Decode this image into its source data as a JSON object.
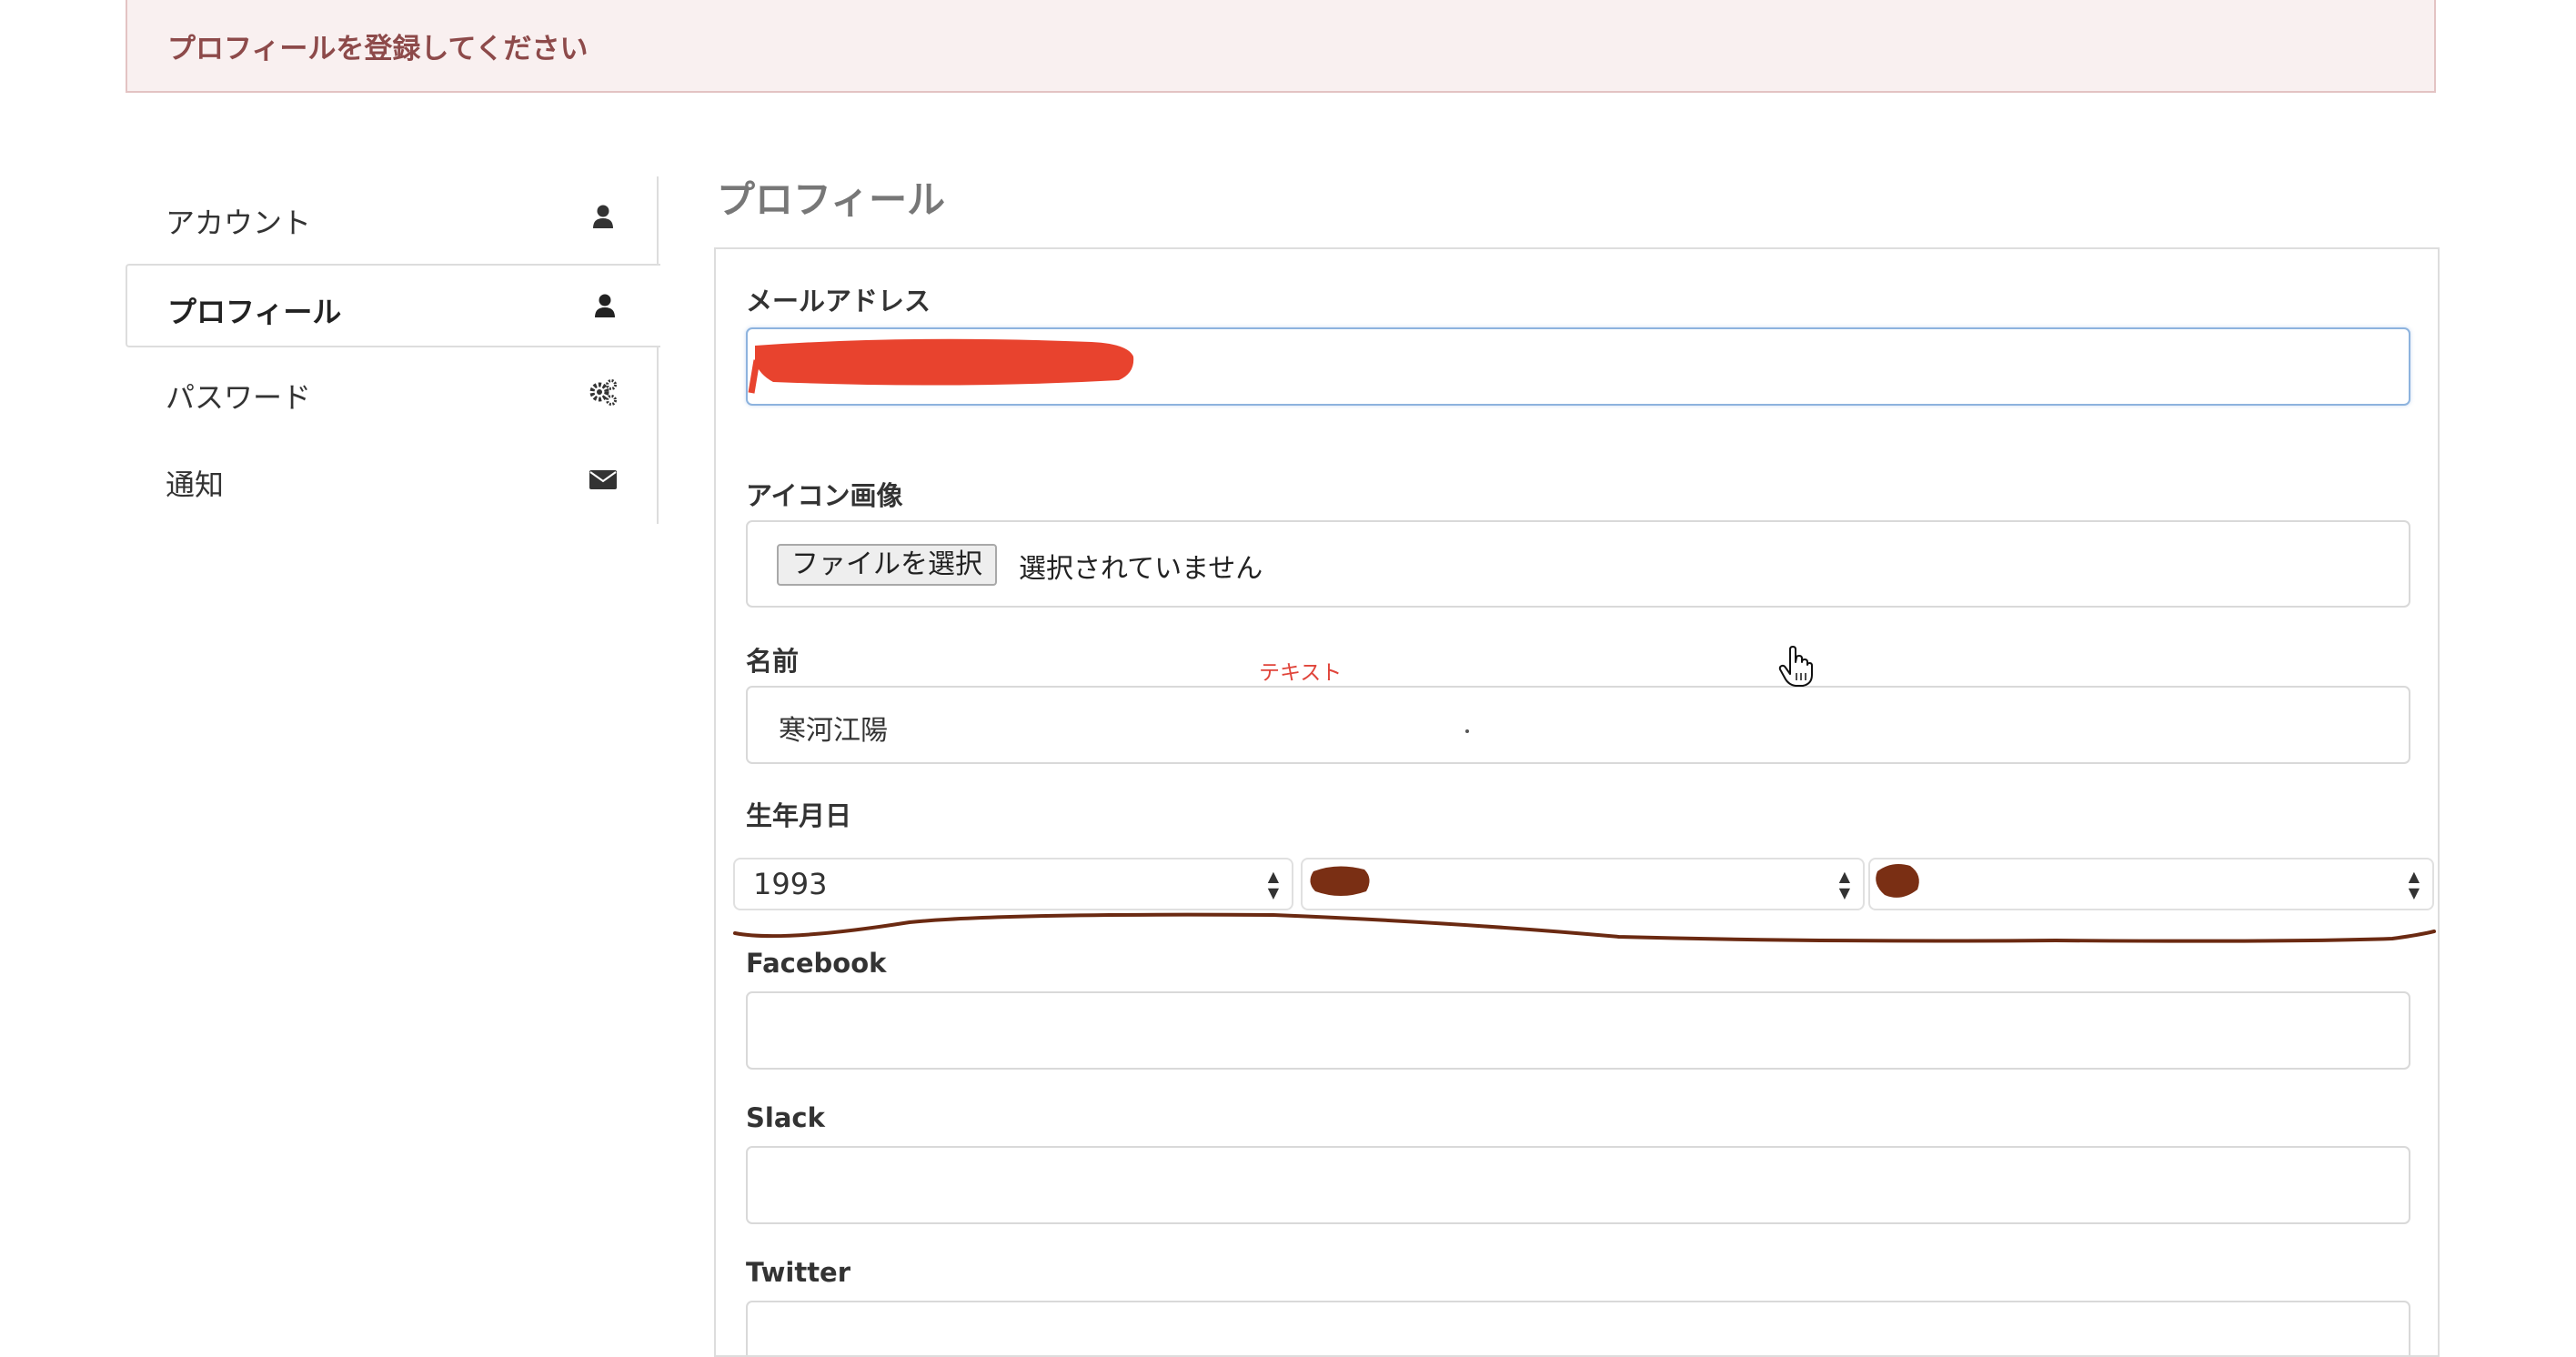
{
  "alert": {
    "message": "プロフィールを登録してください"
  },
  "sidebar": {
    "items": [
      {
        "label": "アカウント",
        "icon": "user-icon",
        "active": false
      },
      {
        "label": "プロフィール",
        "icon": "user-icon",
        "active": true
      },
      {
        "label": "パスワード",
        "icon": "gears-icon",
        "active": false
      },
      {
        "label": "通知",
        "icon": "envelope-icon",
        "active": false
      }
    ]
  },
  "main": {
    "title": "プロフィール",
    "email": {
      "label": "メールアドレス",
      "value": ""
    },
    "icon_image": {
      "label": "アイコン画像",
      "button": "ファイルを選択",
      "status": "選択されていません"
    },
    "name": {
      "label": "名前",
      "value": "寒河江陽"
    },
    "birthday": {
      "label": "生年月日",
      "year": "1993",
      "month": "",
      "day": ""
    },
    "facebook": {
      "label": "Facebook",
      "value": ""
    },
    "slack": {
      "label": "Slack",
      "value": ""
    },
    "twitter": {
      "label": "Twitter",
      "value": ""
    }
  },
  "annotation": {
    "text": "テキスト"
  },
  "colors": {
    "alert_text": "#8d4a4a",
    "alert_bg": "#f9f0f0",
    "redaction_red": "#e8432e",
    "redaction_brown": "#7a2f14",
    "annotation_red": "#e0443a"
  }
}
